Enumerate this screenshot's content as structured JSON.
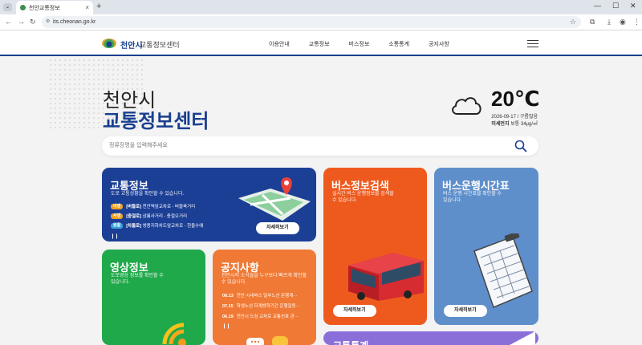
{
  "browser": {
    "tab_title": "천안교통정보",
    "tab_close": "×",
    "new_tab": "+",
    "url": "its.cheonan.go.kr",
    "win_min": "—",
    "win_max": "☐",
    "win_close": "✕"
  },
  "header": {
    "logo_city": "천안시",
    "logo_title": "교통정보센터",
    "nav": [
      "이용안내",
      "교통정보",
      "버스정보",
      "소통통계",
      "공지사항"
    ]
  },
  "hero": {
    "sub": "천안시",
    "title": "교통정보센터"
  },
  "weather": {
    "temperature": "20℃",
    "date_condition": "2026-09-17 / 구름많음",
    "dust_label": "미세먼지",
    "dust_value": " 보통 34μg/㎥"
  },
  "search": {
    "placeholder": "정류장명을 입력해주세요"
  },
  "cards": {
    "traffic": {
      "title": "교통정보",
      "desc": "도로 교통상황을 확인할 수 있습니다.",
      "roads": [
        {
          "badge": "비엔",
          "road": "[버들로]",
          "text": "천안역앞교차로 - 버들육거리",
          "color": "#f0a020"
        },
        {
          "badge": "서행",
          "road": "[충절로]",
          "text": "삼룡사거리 - 충절오거리",
          "color": "#f0a020"
        },
        {
          "badge": "원활",
          "road": "[차돌로]",
          "text": "쌍용지하차도앞교차로 - 한울수애",
          "color": "#3aa3d8"
        }
      ],
      "pause": "❙❙",
      "more": "자세히보기"
    },
    "bus": {
      "title": "버스정보검색",
      "desc": "실시간 버스 운행정보를 검색할 수 있습니다.",
      "more": "자세히보기"
    },
    "schedule": {
      "title": "버스운행시간표",
      "desc": "버스 운행 시간표를 확인할 수 있습니다.",
      "more": "자세히보기"
    },
    "video": {
      "title": "영상정보",
      "desc": "도로영상 정보를 확인할 수 있습니다."
    },
    "notice": {
      "title": "공지사항",
      "desc": "천안시의 소식들을 누구보다 빠르게 확인할 수 있습니다.",
      "items": [
        {
          "date": "08.13",
          "text": "천안 시내버스 일부노선 운행계···"
        },
        {
          "date": "07.15",
          "text": "학생노선 하계방학기간 운행일동···"
        },
        {
          "date": "06.19",
          "text": "천안시 도심 교차로 교통신호 관···"
        }
      ],
      "pause": "❙❙"
    },
    "stats": {
      "title": "교통통계"
    }
  }
}
